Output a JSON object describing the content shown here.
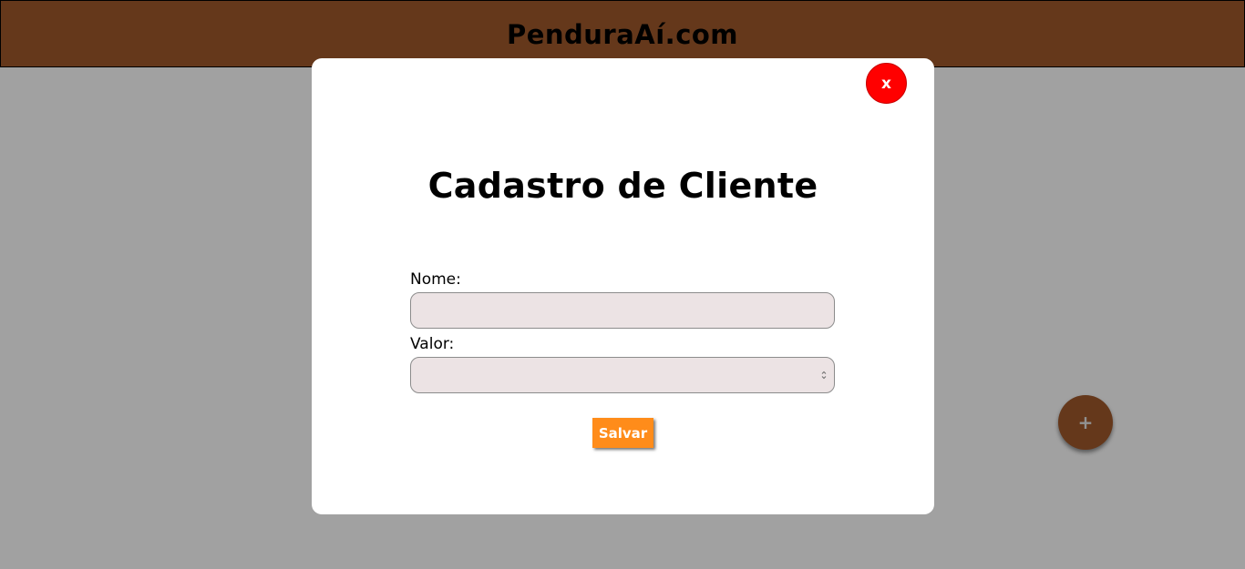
{
  "header": {
    "title": "PenduraAí.com",
    "background_color": "#a05a2c"
  },
  "fab": {
    "label": "+",
    "icon": "plus-icon"
  },
  "modal": {
    "close_label": "x",
    "close_color": "#ff0000",
    "title": "Cadastro de Cliente",
    "fields": {
      "nome": {
        "label": "Nome:",
        "value": "",
        "placeholder": ""
      },
      "valor": {
        "label": "Valor:",
        "value": "",
        "placeholder": ""
      }
    },
    "save_label": "Salvar",
    "save_color": "#ff8c1a"
  }
}
